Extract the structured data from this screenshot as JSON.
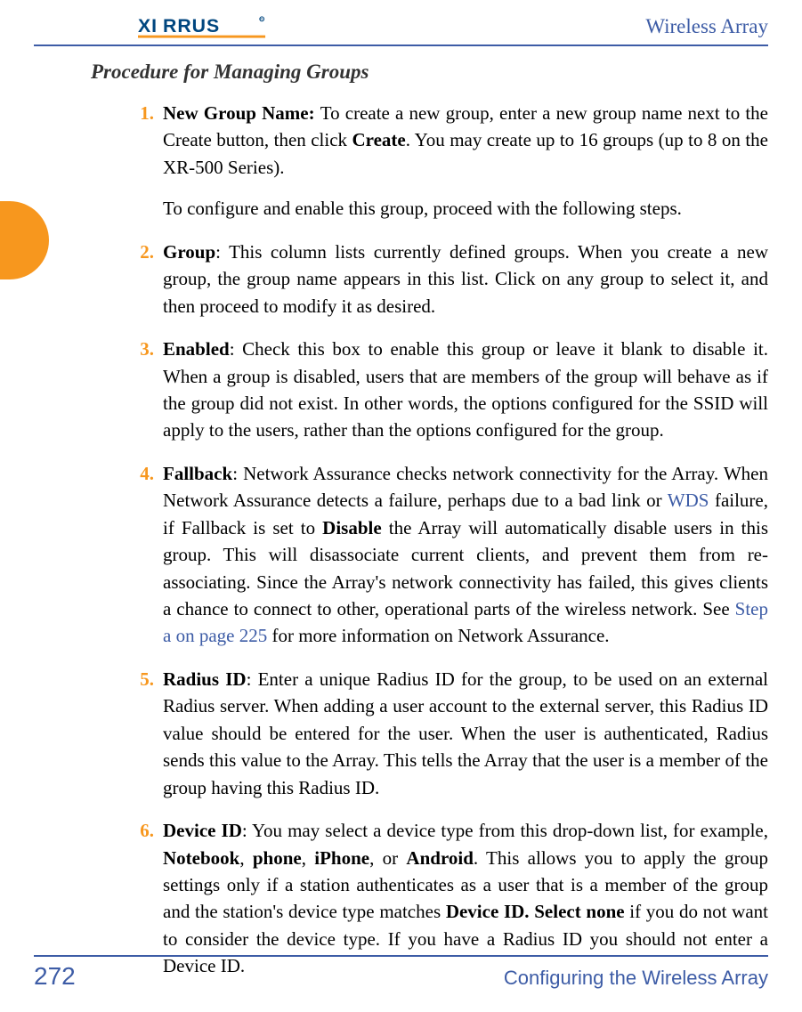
{
  "header": {
    "brand": "XIRRUS",
    "right": "Wireless Array"
  },
  "heading": "Procedure for Managing Groups",
  "items": [
    {
      "num": "1.",
      "para1_bold1": "New Group Name: ",
      "para1_p1": "To create a new group, enter a new group name next to the Create button, then click ",
      "para1_bold2": "Create",
      "para1_p2": ". You may create up to 16 groups (up to 8 on the XR-500 Series).",
      "para2": "To configure and enable this group, proceed with the following steps."
    },
    {
      "num": "2.",
      "bold": "Group",
      "p1": ": This column lists currently defined groups. When you create a new group, the group name appears in this list. Click on any group to select it, and then proceed to modify it as desired."
    },
    {
      "num": "3.",
      "bold": "Enabled",
      "p1": ": Check this box to enable this group or leave it blank to disable it. When a group is disabled, users that are members of the group will behave as if the group did not exist. In other words, the options configured for the SSID will apply to the users, rather than the options configured for the group."
    },
    {
      "num": "4.",
      "bold": "Fallback",
      "p1": ": Network Assurance checks network connectivity for the Array. When Network Assurance detects a failure, perhaps due to a bad link or ",
      "link1": "WDS",
      "p2": " failure, if Fallback is set to ",
      "bold2": "Disable",
      "p3": " the Array will automatically disable users in this group. This will disassociate current clients, and prevent them from re-associating. Since the Array's network connectivity has failed, this gives clients a chance to connect to other, operational parts of the wireless network. See ",
      "link2": "Step a on page 225",
      "p4": " for more information on Network Assurance."
    },
    {
      "num": "5.",
      "bold": "Radius ID",
      "p1": ": Enter a unique Radius ID for the group, to be used on an external Radius server. When adding a user account to the external server, this Radius ID value should be entered for the user. When the user is authenticated, Radius sends this value to the Array. This tells the Array that the user is a member of the group having this Radius ID."
    },
    {
      "num": "6.",
      "bold": "Device ID",
      "p1": ": You may select a device type from this drop-down list, for example, ",
      "bold2": "Notebook",
      "p2": ", ",
      "bold3": "phone",
      "p3": ", ",
      "bold4": "iPhone",
      "p4": ", or ",
      "bold5": "Android",
      "p5": ". This allows you to apply the group settings only if a station authenticates as a user that is a member of the group and the station's device type matches ",
      "bold6": "Device ID. Select none",
      "p6": " if you do not want to consider the device type. If you have a Radius ID you should not enter a Device ID."
    }
  ],
  "footer": {
    "page": "272",
    "right": "Configuring the Wireless Array"
  }
}
